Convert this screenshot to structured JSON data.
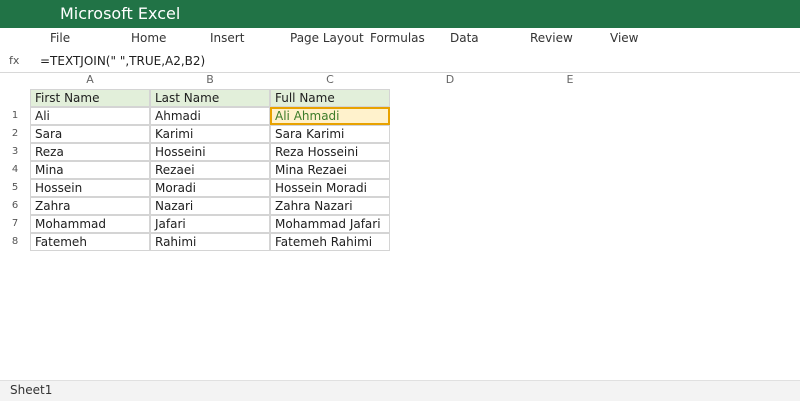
{
  "app": {
    "title": "Microsoft Excel",
    "accent": "#217346"
  },
  "menu": [
    "File",
    "Home",
    "Insert",
    "Page Layout",
    "Formulas",
    "Data",
    "Review",
    "View"
  ],
  "formula_bar": {
    "label": "fx",
    "value": "=TEXTJOIN(\" \",TRUE,A2,B2)"
  },
  "columns": [
    "A",
    "B",
    "C",
    "D",
    "E"
  ],
  "rows": [
    "1",
    "2",
    "3",
    "4",
    "5",
    "6",
    "7",
    "8"
  ],
  "sheet": {
    "header": [
      "First Name",
      "Last Name",
      "Full Name"
    ],
    "data": [
      [
        "Ali",
        "Ahmadi",
        "Ali Ahmadi"
      ],
      [
        "Sara",
        "Karimi",
        "Sara Karimi"
      ],
      [
        "Reza",
        "Hosseini",
        "Reza Hosseini"
      ],
      [
        "Mina",
        "Rezaei",
        "Mina Rezaei"
      ],
      [
        "Hossein",
        "Moradi",
        "Hossein Moradi"
      ],
      [
        "Zahra",
        "Nazari",
        "Zahra Nazari"
      ],
      [
        "Mohammad",
        "Jafari",
        "Mohammad Jafari"
      ],
      [
        "Fatemeh",
        "Rahimi",
        "Fatemeh Rahimi"
      ]
    ],
    "selected_cell": "Ali Ahmadi"
  },
  "status": {
    "sheet_tab": "Sheet1"
  }
}
